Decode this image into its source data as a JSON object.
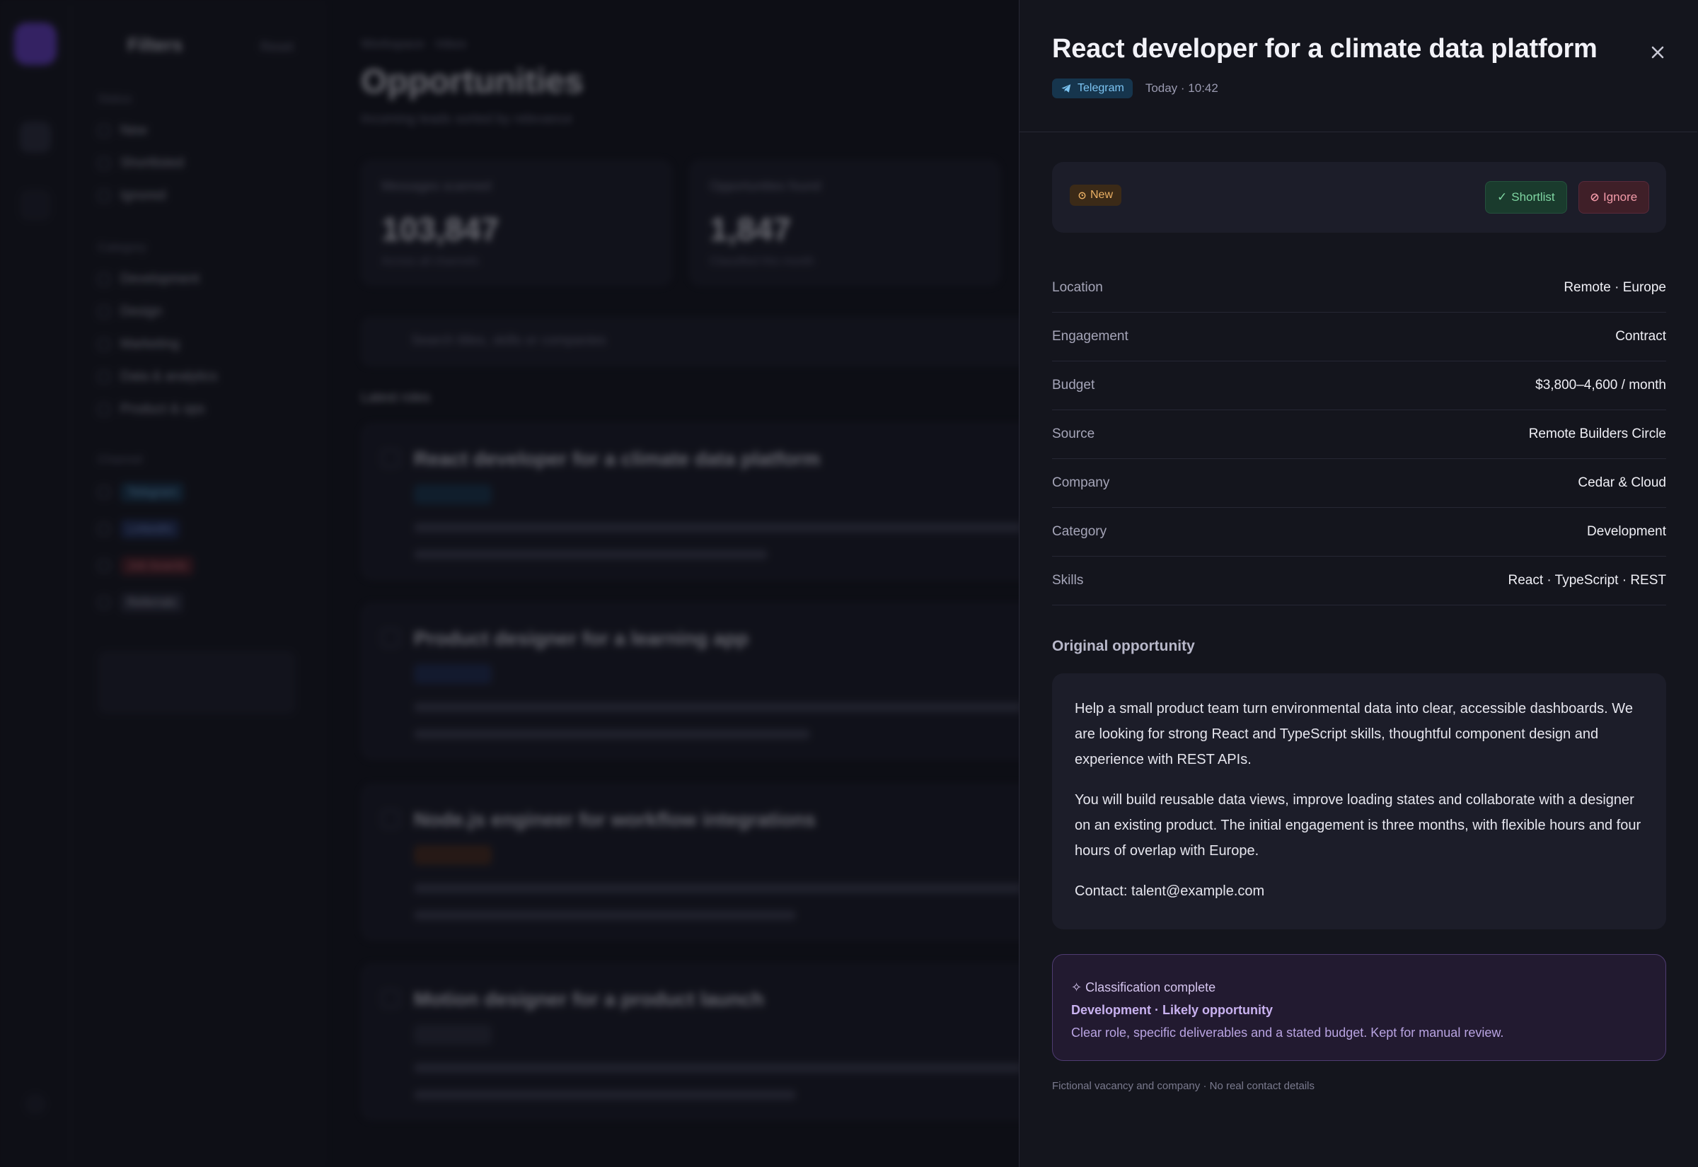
{
  "background": {
    "filters_title": "Filters",
    "filters_reset": "Reset",
    "filter_groups": [
      "Status",
      "Category",
      "Channel"
    ],
    "status_items": [
      "New",
      "Shortlisted",
      "Ignored"
    ],
    "category_items": [
      "Development",
      "Design",
      "Marketing",
      "Data & analytics",
      "Product & ops"
    ],
    "channel_items": [
      "Telegram",
      "LinkedIn",
      "Job boards",
      "Referrals"
    ],
    "breadcrumb": "Workspace · Inbox",
    "page_title": "Opportunities",
    "page_subtitle": "Incoming leads sorted by relevance",
    "stats": [
      {
        "label": "Messages scanned",
        "value": "103,847",
        "delta": "Across all channels"
      },
      {
        "label": "Opportunities found",
        "value": "1,847",
        "delta": "Classified this month"
      }
    ],
    "search_placeholder": "Search titles, skills or companies",
    "list_heading": "Latest roles",
    "list_cards": [
      "React developer for a climate data platform",
      "Product designer for a learning app",
      "Node.js engineer for workflow integrations",
      "Motion designer for a product launch"
    ]
  },
  "drawer": {
    "title": "React developer for a climate data platform",
    "channel": "Telegram",
    "timestamp": "Today · 10:42",
    "status_label": "New",
    "shortlist_label": "Shortlist",
    "ignore_label": "Ignore",
    "details": [
      {
        "key": "Location",
        "value": "Remote · Europe"
      },
      {
        "key": "Engagement",
        "value": "Contract"
      },
      {
        "key": "Budget",
        "value": "$3,800–4,600 / month"
      },
      {
        "key": "Source",
        "value": "Remote Builders Circle"
      },
      {
        "key": "Company",
        "value": "Cedar & Cloud"
      },
      {
        "key": "Category",
        "value": "Development"
      },
      {
        "key": "Skills",
        "value": "React · TypeScript · REST"
      }
    ],
    "original_heading": "Original opportunity",
    "original_paragraphs": [
      "Help a small product team turn environmental data into clear, accessible dashboards. We are looking for strong React and TypeScript skills, thoughtful component design and experience with REST APIs.",
      "You will build reusable data views, improve loading states and collaborate with a designer on an existing product. The initial engagement is three months, with flexible hours and four hours of overlap with Europe.",
      "Contact: talent@example.com"
    ],
    "classification": {
      "status": "✧ Classification complete",
      "result": "Development · Likely opportunity",
      "reason": "Clear role, specific deliverables and a stated budget. Kept for manual review."
    },
    "footnote": "Fictional vacancy and company · No real contact details"
  },
  "colors": {
    "accent_purple": "#6a3fd0",
    "telegram_badge": "#16354d",
    "new_badge": "#eab064",
    "shortlist": "#7fd6a2",
    "ignore": "#f29aa8"
  }
}
